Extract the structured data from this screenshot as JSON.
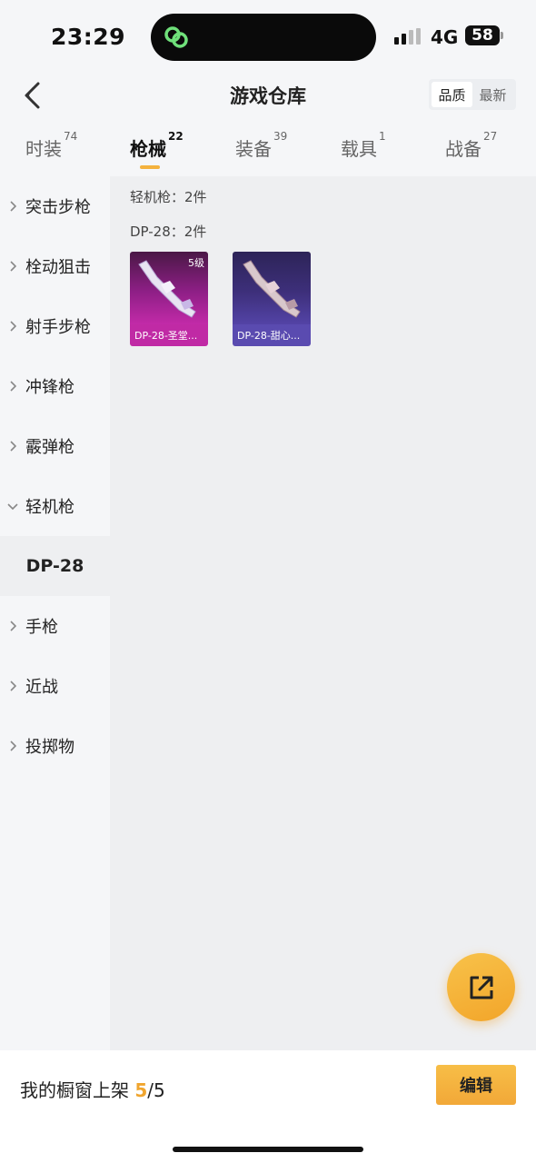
{
  "status_bar": {
    "time": "23:29",
    "network": "4G",
    "battery": "58"
  },
  "header": {
    "title": "游戏仓库",
    "sort_options": [
      "品质",
      "最新"
    ],
    "sort_active": "品质"
  },
  "tabs": [
    {
      "label": "时装",
      "count": "74"
    },
    {
      "label": "枪械",
      "count": "22"
    },
    {
      "label": "装备",
      "count": "39"
    },
    {
      "label": "载具",
      "count": "1"
    },
    {
      "label": "战备",
      "count": "27"
    }
  ],
  "active_tab": "枪械",
  "sidebar": {
    "items": [
      {
        "label": "突击步枪"
      },
      {
        "label": "栓动狙击"
      },
      {
        "label": "射手步枪"
      },
      {
        "label": "冲锋枪"
      },
      {
        "label": "霰弹枪"
      },
      {
        "label": "轻机枪"
      },
      {
        "label": "DP-28"
      },
      {
        "label": "手枪"
      },
      {
        "label": "近战"
      },
      {
        "label": "投掷物"
      }
    ]
  },
  "main": {
    "category_label": "轻机枪：2件",
    "subgroup_label": "DP-28：2件",
    "items": [
      {
        "name": "DP-28-圣堂...",
        "level": "5级",
        "rarity_color": "#b5259c"
      },
      {
        "name": "DP-28-甜心...",
        "level": "",
        "rarity_color": "#4c3a9a"
      }
    ]
  },
  "bottom_bar": {
    "shelf_prefix": "我的橱窗上架 ",
    "shelf_current": "5",
    "shelf_total": "/5",
    "edit_label": "编辑"
  },
  "colors": {
    "accent": "#f4b23d"
  }
}
